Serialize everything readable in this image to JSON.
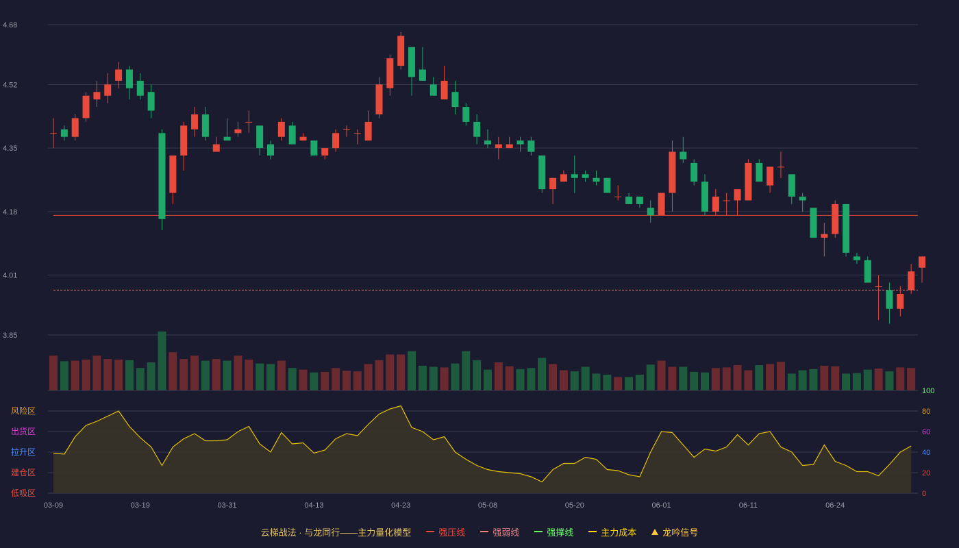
{
  "chart_data": {
    "type": "candlestick",
    "price_axis": {
      "ticks": [
        "4.68",
        "4.52",
        "4.35",
        "4.18",
        "4.01",
        "3.85"
      ],
      "ylim": [
        3.85,
        4.68
      ]
    },
    "indicator_axis": {
      "ticks": [
        100,
        80,
        60,
        40,
        20,
        0
      ],
      "ylim": [
        0,
        100
      ]
    },
    "zone_labels": [
      "风险区",
      "出货区",
      "拉升区",
      "建仓区",
      "低吸区"
    ],
    "x_tick_labels": [
      "03-09",
      "03-19",
      "03-31",
      "04-13",
      "04-23",
      "05-08",
      "05-20",
      "06-01",
      "06-11",
      "06-24"
    ],
    "x_tick_indices": [
      0,
      8,
      16,
      24,
      32,
      40,
      48,
      56,
      64,
      72
    ],
    "reference_lines": {
      "strong_pressure": 4.17,
      "strong_weak": 3.97
    },
    "candles": [
      [
        4.39,
        4.43,
        4.35,
        4.39
      ],
      [
        4.4,
        4.41,
        4.37,
        4.38
      ],
      [
        4.38,
        4.44,
        4.37,
        4.43
      ],
      [
        4.43,
        4.5,
        4.42,
        4.49
      ],
      [
        4.48,
        4.53,
        4.46,
        4.5
      ],
      [
        4.49,
        4.55,
        4.47,
        4.52
      ],
      [
        4.53,
        4.58,
        4.51,
        4.56
      ],
      [
        4.56,
        4.57,
        4.48,
        4.51
      ],
      [
        4.53,
        4.55,
        4.48,
        4.49
      ],
      [
        4.5,
        4.52,
        4.43,
        4.45
      ],
      [
        4.39,
        4.4,
        4.13,
        4.16
      ],
      [
        4.23,
        4.33,
        4.2,
        4.33
      ],
      [
        4.33,
        4.42,
        4.29,
        4.41
      ],
      [
        4.4,
        4.46,
        4.38,
        4.44
      ],
      [
        4.44,
        4.46,
        4.37,
        4.38
      ],
      [
        4.34,
        4.38,
        4.34,
        4.36
      ],
      [
        4.38,
        4.43,
        4.37,
        4.37
      ],
      [
        4.39,
        4.42,
        4.38,
        4.4
      ],
      [
        4.42,
        4.45,
        4.39,
        4.42
      ],
      [
        4.41,
        4.41,
        4.33,
        4.35
      ],
      [
        4.36,
        4.37,
        4.32,
        4.33
      ],
      [
        4.38,
        4.43,
        4.37,
        4.42
      ],
      [
        4.41,
        4.42,
        4.36,
        4.36
      ],
      [
        4.37,
        4.39,
        4.37,
        4.38
      ],
      [
        4.37,
        4.37,
        4.33,
        4.33
      ],
      [
        4.33,
        4.35,
        4.32,
        4.35
      ],
      [
        4.35,
        4.4,
        4.34,
        4.39
      ],
      [
        4.4,
        4.41,
        4.38,
        4.4
      ],
      [
        4.39,
        4.4,
        4.36,
        4.39
      ],
      [
        4.37,
        4.45,
        4.37,
        4.42
      ],
      [
        4.44,
        4.54,
        4.43,
        4.52
      ],
      [
        4.51,
        4.6,
        4.49,
        4.59
      ],
      [
        4.57,
        4.66,
        4.56,
        4.65
      ],
      [
        4.62,
        4.62,
        4.49,
        4.54
      ],
      [
        4.56,
        4.62,
        4.53,
        4.53
      ],
      [
        4.52,
        4.54,
        4.49,
        4.49
      ],
      [
        4.48,
        4.57,
        4.48,
        4.53
      ],
      [
        4.5,
        4.53,
        4.44,
        4.46
      ],
      [
        4.46,
        4.47,
        4.41,
        4.42
      ],
      [
        4.42,
        4.44,
        4.36,
        4.38
      ],
      [
        4.37,
        4.4,
        4.35,
        4.36
      ],
      [
        4.35,
        4.38,
        4.32,
        4.36
      ],
      [
        4.35,
        4.38,
        4.35,
        4.36
      ],
      [
        4.37,
        4.38,
        4.34,
        4.36
      ],
      [
        4.37,
        4.38,
        4.33,
        4.34
      ],
      [
        4.33,
        4.33,
        4.23,
        4.24
      ],
      [
        4.24,
        4.27,
        4.2,
        4.27
      ],
      [
        4.26,
        4.29,
        4.26,
        4.28
      ],
      [
        4.28,
        4.33,
        4.23,
        4.27
      ],
      [
        4.28,
        4.29,
        4.26,
        4.27
      ],
      [
        4.27,
        4.29,
        4.25,
        4.26
      ],
      [
        4.27,
        4.27,
        4.23,
        4.23
      ],
      [
        4.22,
        4.25,
        4.21,
        4.22
      ],
      [
        4.22,
        4.23,
        4.21,
        4.2
      ],
      [
        4.22,
        4.22,
        4.19,
        4.2
      ],
      [
        4.19,
        4.21,
        4.15,
        4.17
      ],
      [
        4.17,
        4.23,
        4.17,
        4.23
      ],
      [
        4.23,
        4.37,
        4.18,
        4.34
      ],
      [
        4.34,
        4.38,
        4.31,
        4.32
      ],
      [
        4.31,
        4.32,
        4.25,
        4.26
      ],
      [
        4.26,
        4.28,
        4.17,
        4.18
      ],
      [
        4.18,
        4.24,
        4.17,
        4.22
      ],
      [
        4.21,
        4.23,
        4.17,
        4.21
      ],
      [
        4.21,
        4.24,
        4.17,
        4.24
      ],
      [
        4.21,
        4.32,
        4.21,
        4.31
      ],
      [
        4.31,
        4.32,
        4.26,
        4.26
      ],
      [
        4.25,
        4.3,
        4.23,
        4.3
      ],
      [
        4.3,
        4.34,
        4.27,
        4.3
      ],
      [
        4.28,
        4.28,
        4.2,
        4.22
      ],
      [
        4.22,
        4.23,
        4.18,
        4.21
      ],
      [
        4.19,
        4.19,
        4.11,
        4.11
      ],
      [
        4.11,
        4.15,
        4.06,
        4.12
      ],
      [
        4.12,
        4.21,
        4.11,
        4.2
      ],
      [
        4.2,
        4.2,
        4.06,
        4.07
      ],
      [
        4.06,
        4.07,
        4.04,
        4.05
      ],
      [
        4.05,
        4.06,
        3.99,
        3.99
      ],
      [
        3.98,
        4.01,
        3.89,
        3.98
      ],
      [
        3.97,
        3.99,
        3.88,
        3.92
      ],
      [
        3.92,
        3.98,
        3.9,
        3.96
      ],
      [
        3.97,
        4.04,
        3.96,
        4.02
      ],
      [
        4.03,
        4.05,
        3.99,
        4.06
      ]
    ],
    "volume": [
      0.62,
      0.52,
      0.53,
      0.55,
      0.62,
      0.56,
      0.55,
      0.54,
      0.4,
      0.5,
      1.05,
      0.68,
      0.56,
      0.62,
      0.53,
      0.56,
      0.53,
      0.62,
      0.55,
      0.48,
      0.47,
      0.53,
      0.4,
      0.37,
      0.32,
      0.33,
      0.4,
      0.35,
      0.34,
      0.47,
      0.54,
      0.64,
      0.64,
      0.7,
      0.44,
      0.42,
      0.41,
      0.48,
      0.7,
      0.54,
      0.37,
      0.5,
      0.43,
      0.38,
      0.4,
      0.58,
      0.47,
      0.36,
      0.34,
      0.42,
      0.3,
      0.28,
      0.24,
      0.24,
      0.28,
      0.46,
      0.53,
      0.42,
      0.42,
      0.33,
      0.32,
      0.4,
      0.41,
      0.45,
      0.36,
      0.45,
      0.47,
      0.51,
      0.3,
      0.36,
      0.38,
      0.44,
      0.43,
      0.3,
      0.31,
      0.37,
      0.39,
      0.34,
      0.41,
      0.4
    ],
    "signal_line": [
      39,
      38,
      55,
      66,
      70,
      75,
      80,
      65,
      54,
      45,
      27,
      45,
      53,
      58,
      51,
      51,
      52,
      60,
      65,
      48,
      40,
      59,
      48,
      49,
      39,
      42,
      53,
      58,
      56,
      67,
      77,
      82,
      85,
      64,
      60,
      52,
      55,
      40,
      33,
      27,
      23,
      21,
      20,
      19,
      16,
      11,
      23,
      29,
      29,
      35,
      33,
      23,
      22,
      18,
      16,
      40,
      60,
      59,
      47,
      35,
      43,
      41,
      45,
      57,
      47,
      58,
      60,
      45,
      40,
      27,
      28,
      47,
      31,
      27,
      21,
      21,
      17,
      28,
      40,
      46
    ]
  },
  "legend": [
    {
      "label": "云梯战法 · 与龙同行——主力量化模型",
      "symbol": "none",
      "color": "#e0c060"
    },
    {
      "label": "强压线",
      "symbol": "solid",
      "color": "#e74c3c"
    },
    {
      "label": "强弱线",
      "symbol": "dash",
      "color": "#f08080"
    },
    {
      "label": "强撑线",
      "symbol": "solid",
      "color": "#66ff66"
    },
    {
      "label": "主力成本",
      "symbol": "dash",
      "color": "#ffd700"
    },
    {
      "label": "龙吟信号",
      "symbol": "triangle",
      "color": "#ffc740"
    }
  ],
  "colors": {
    "background": "#1a1b2e",
    "up": "#e84a3c",
    "down": "#1ea86a",
    "volume_up": "#6b2a30",
    "volume_down": "#1e5a3e",
    "grid": "#3a3b4e",
    "axis_text": "#9a9aa8",
    "signal_line": "#e6c200",
    "signal_fill": "#3a3428",
    "zone_colors": [
      "#e69a1a",
      "#e03adb",
      "#4a8cff",
      "#e84a3c",
      "#e84a3c"
    ],
    "indicator_tick_colors": [
      "#66ff66",
      "#e69a1a",
      "#e03adb",
      "#4a8cff",
      "#e84a3c",
      "#e84a3c"
    ]
  }
}
